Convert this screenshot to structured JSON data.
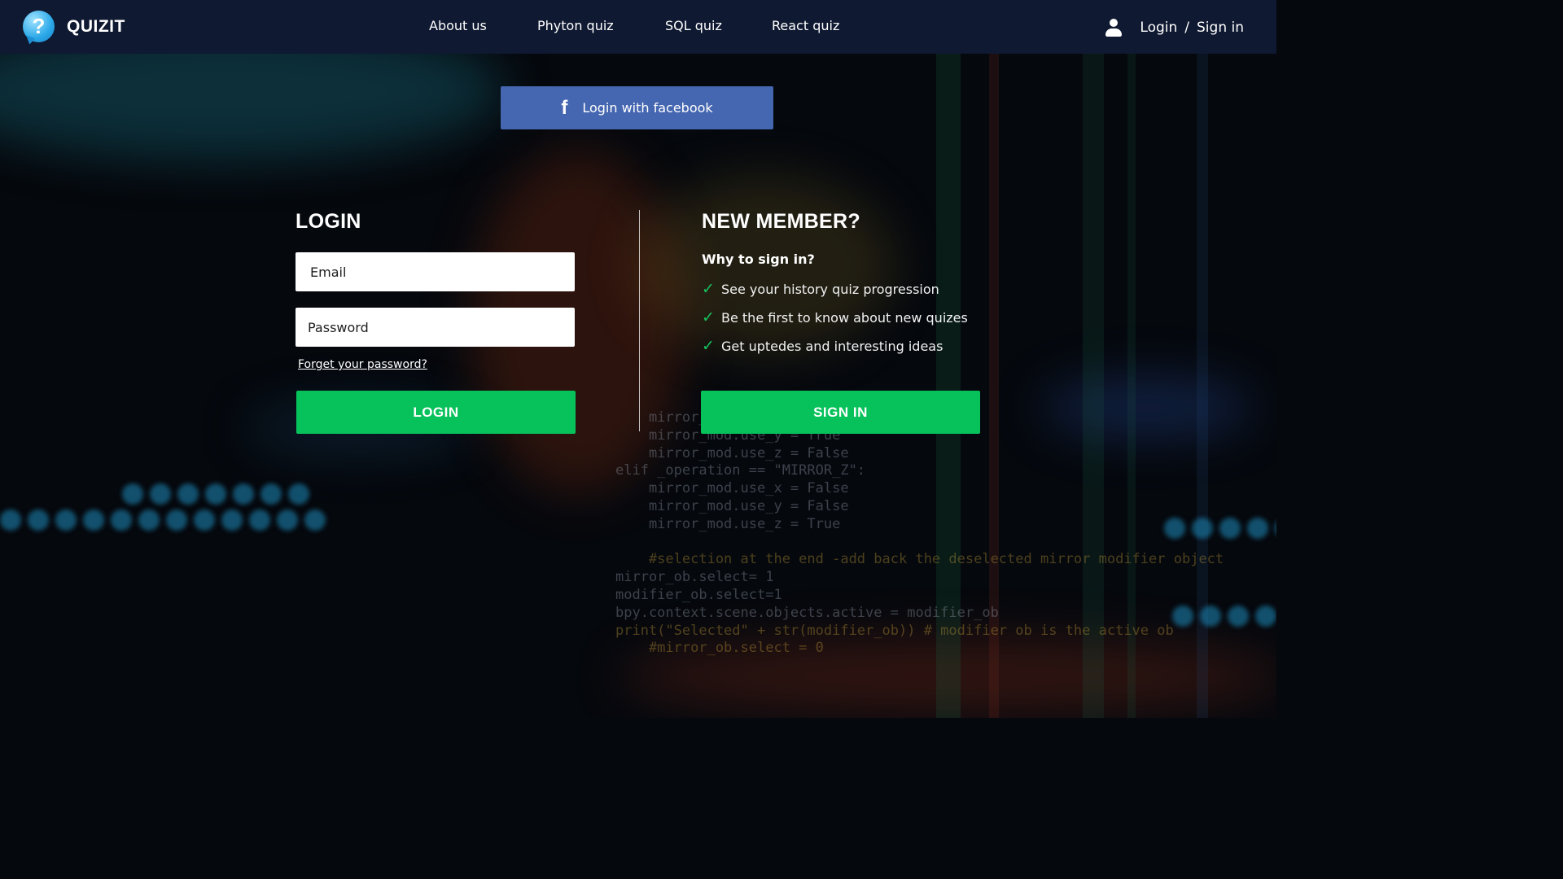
{
  "brand": {
    "name": "QUIZIT",
    "logo_glyph": "?"
  },
  "nav": {
    "items": [
      {
        "label": "About us"
      },
      {
        "label": "Phyton quiz"
      },
      {
        "label": "SQL quiz"
      },
      {
        "label": "React quiz"
      }
    ]
  },
  "account": {
    "login_label": "Login",
    "separator": "/",
    "signin_label": "Sign in"
  },
  "facebook": {
    "label": "Login with facebook",
    "icon_glyph": "f"
  },
  "login_form": {
    "title": "LOGIN",
    "email_placeholder": "Email",
    "password_placeholder": "Password",
    "forgot_label": "Forget your password?",
    "submit_label": "LOGIN"
  },
  "signup": {
    "title": "NEW MEMBER?",
    "subtitle": "Why to sign in?",
    "benefits": [
      {
        "text": "See your history quiz progression"
      },
      {
        "text": "Be the first to know about new quizes"
      },
      {
        "text": "Get uptedes and interesting ideas"
      }
    ],
    "submit_label": "SIGN IN"
  },
  "background_code": {
    "lines": [
      "    mirror_mod.use_x = False",
      "    mirror_mod.use_y = True",
      "    mirror_mod.use_z = False",
      "elif _operation == \"MIRROR_Z\":",
      "    mirror_mod.use_x = False",
      "    mirror_mod.use_y = False",
      "    mirror_mod.use_z = True",
      "",
      "    #selection at the end -add back the deselected mirror modifier object",
      "mirror_ob.select= 1",
      "modifier_ob.select=1",
      "bpy.context.scene.objects.active = modifier_ob",
      "print(\"Selected\" + str(modifier_ob)) # modifier ob is the active ob",
      "    #mirror_ob.select = 0"
    ]
  },
  "colors": {
    "header_bg": "#0f1931",
    "facebook_blue": "#4566b0",
    "action_green": "#07c25b",
    "check_green": "#16c15d",
    "logo_blue": "#2aa7e8"
  }
}
